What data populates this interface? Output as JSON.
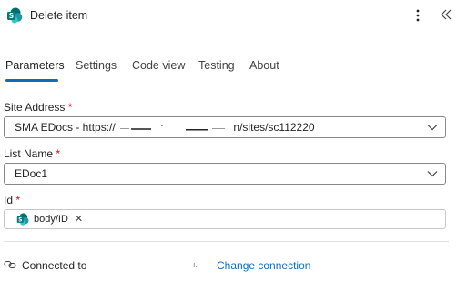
{
  "header": {
    "title": "Delete item",
    "app_icon": "sharepoint-icon",
    "more_icon": "more-vertical-icon",
    "collapse_icon": "double-chevron-left-icon"
  },
  "tabs": [
    {
      "label": "Parameters",
      "active": true
    },
    {
      "label": "Settings",
      "active": false
    },
    {
      "label": "Code view",
      "active": false
    },
    {
      "label": "Testing",
      "active": false
    },
    {
      "label": "About",
      "active": false
    }
  ],
  "fields": {
    "site_address": {
      "label": "Site Address",
      "required_mark": "*",
      "value_prefix": "SMA EDocs - https://",
      "value_suffix": "n/sites/sc112220"
    },
    "list_name": {
      "label": "List Name",
      "required_mark": "*",
      "value": "EDoc1"
    },
    "id": {
      "label": "Id",
      "required_mark": "*",
      "token_label": "body/ID",
      "token_remove": "✕"
    }
  },
  "connection": {
    "status_text": "Connected to ",
    "change_label": "Change connection"
  },
  "colors": {
    "accent": "#0f6cbd",
    "required": "#c50f1f",
    "sharepoint": "#038387"
  }
}
